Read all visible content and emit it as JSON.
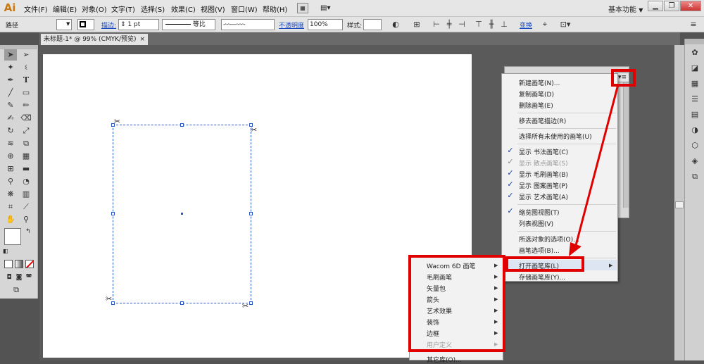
{
  "app": {
    "logo": "Ai",
    "menus": [
      "文件(F)",
      "编辑(E)",
      "对象(O)",
      "文字(T)",
      "选择(S)",
      "效果(C)",
      "视图(V)",
      "窗口(W)",
      "帮助(H)"
    ],
    "workspace": "基本功能",
    "workspace_arrow": "▼",
    "win_min": "▁",
    "win_restore": "❐",
    "win_close": "✕"
  },
  "control": {
    "selection_label": "路径",
    "stroke_label": "描边:",
    "stroke_value": "1 pt",
    "ratio_label": "等比",
    "opacity_label": "不透明度",
    "opacity_value": "100%",
    "style_label": "样式:",
    "transform_label": "变换"
  },
  "document": {
    "tab_title": "未标题-1* @ 99% (CMYK/预览)",
    "tab_close": "×"
  },
  "brush_menu": {
    "items": [
      {
        "label": "新建画笔(N)...",
        "checked": false,
        "dim": false
      },
      {
        "label": "复制画笔(D)",
        "checked": false,
        "dim": false
      },
      {
        "label": "删除画笔(E)",
        "checked": false,
        "dim": false
      },
      {
        "label": "移去画笔描边(R)",
        "checked": false,
        "dim": false
      },
      {
        "label": "选择所有未使用的画笔(U)",
        "checked": false,
        "dim": false
      },
      {
        "label": "显示 书法画笔(C)",
        "checked": true,
        "dim": false
      },
      {
        "label": "显示 散点画笔(S)",
        "checked": true,
        "dim": true
      },
      {
        "label": "显示 毛刷画笔(B)",
        "checked": true,
        "dim": false
      },
      {
        "label": "显示 图案画笔(P)",
        "checked": true,
        "dim": false
      },
      {
        "label": "显示 艺术画笔(A)",
        "checked": true,
        "dim": false
      },
      {
        "label": "缩览图视图(T)",
        "checked": true,
        "dim": false
      },
      {
        "label": "列表视图(V)",
        "checked": false,
        "dim": false
      },
      {
        "label": "所选对象的选项(O)...",
        "checked": false,
        "dim": false
      },
      {
        "label": "画笔选项(B)...",
        "checked": false,
        "dim": false
      },
      {
        "label": "打开画笔库(L)",
        "checked": false,
        "dim": false
      },
      {
        "label": "存储画笔库(Y)...",
        "checked": false,
        "dim": false
      }
    ],
    "check_glyph": "✓"
  },
  "brush_library_submenu": {
    "items": [
      {
        "label": "Wacom 6D 画笔",
        "dim": false
      },
      {
        "label": "毛刷画笔",
        "dim": false
      },
      {
        "label": "矢量包",
        "dim": false
      },
      {
        "label": "箭头",
        "dim": false
      },
      {
        "label": "艺术效果",
        "dim": false
      },
      {
        "label": "装饰",
        "dim": false
      },
      {
        "label": "边框",
        "dim": false
      },
      {
        "label": "用户定义",
        "dim": true
      },
      {
        "label": "其它库(O)...",
        "dim": false
      }
    ]
  },
  "colors": {
    "annotation_red": "#e00000",
    "selection_blue": "#2a56c8"
  }
}
